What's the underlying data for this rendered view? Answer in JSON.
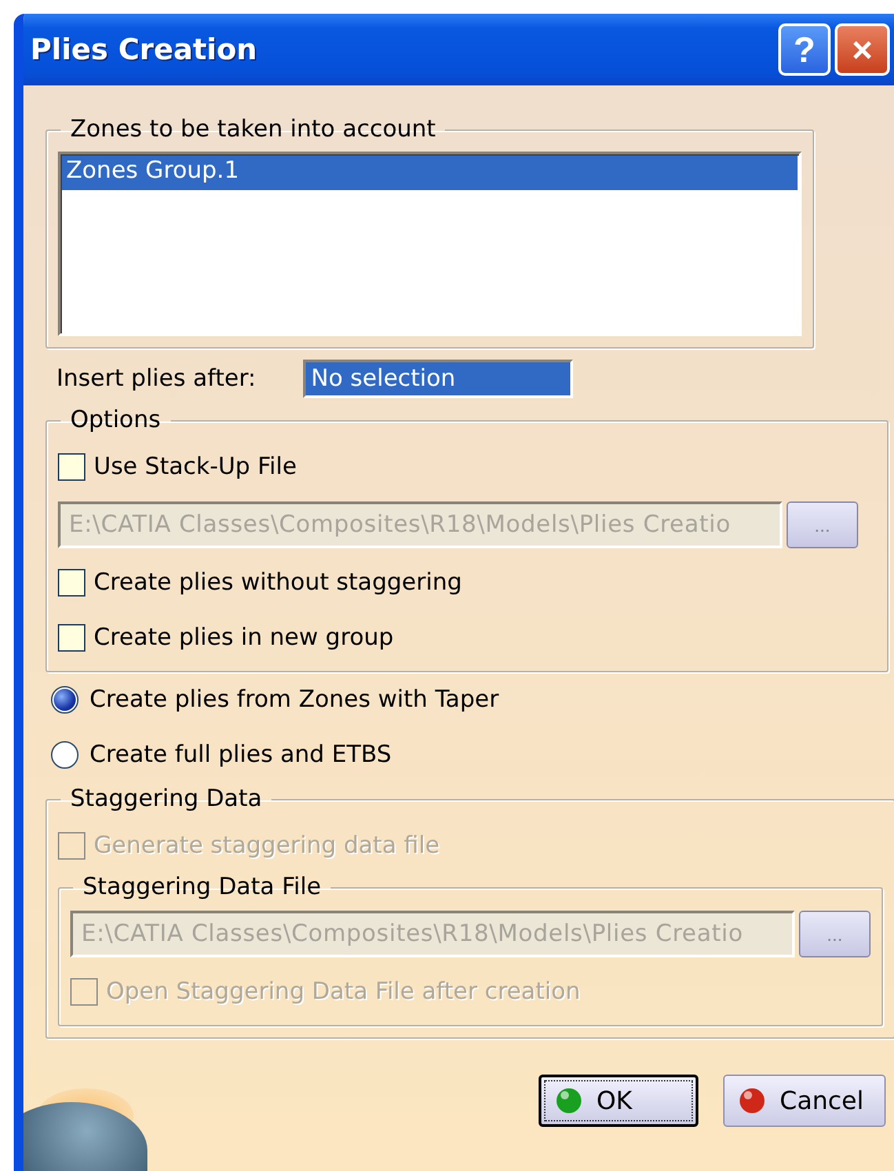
{
  "window": {
    "title": "Plies Creation",
    "buttons": [
      {
        "kind": "help",
        "label": "?"
      },
      {
        "kind": "close",
        "label": "×"
      }
    ]
  },
  "zones_group": {
    "legend": "Zones to be taken into account",
    "items": [
      {
        "label": "Zones Group.1",
        "selected": true
      }
    ]
  },
  "insert_after": {
    "label": "Insert plies after:",
    "value": "No selection"
  },
  "options": {
    "legend": "Options",
    "items": [
      {
        "kind": "checkbox",
        "label": "Use Stack-Up File",
        "checked": false,
        "disabled": false
      },
      {
        "kind": "file",
        "value": "E:\\CATIA Classes\\Composites\\R18\\Models\\Plies Creatio",
        "browse": "...",
        "disabled": true
      },
      {
        "kind": "checkbox",
        "label": "Create plies without staggering",
        "checked": false,
        "disabled": false
      },
      {
        "kind": "checkbox",
        "label": "Create plies in new group",
        "checked": false,
        "disabled": false
      }
    ]
  },
  "radios": [
    {
      "label": "Create plies from Zones with Taper",
      "selected": true
    },
    {
      "label": "Create full plies and ETBS",
      "selected": false
    }
  ],
  "staggering": {
    "legend": "Staggering Data",
    "items": [
      {
        "kind": "checkbox",
        "label": "Generate staggering data file",
        "checked": false,
        "disabled": true
      },
      {
        "kind": "group",
        "legend": "Staggering Data File",
        "items": [
          {
            "kind": "file",
            "value": "E:\\CATIA Classes\\Composites\\R18\\Models\\Plies Creatio",
            "browse": "...",
            "disabled": true
          },
          {
            "kind": "checkbox",
            "label": "Open Staggering Data File after creation",
            "checked": false,
            "disabled": true
          }
        ]
      }
    ]
  },
  "buttons": [
    {
      "kind": "ok",
      "label": "OK",
      "focused": true
    },
    {
      "kind": "cancel",
      "label": "Cancel",
      "focused": false
    }
  ]
}
